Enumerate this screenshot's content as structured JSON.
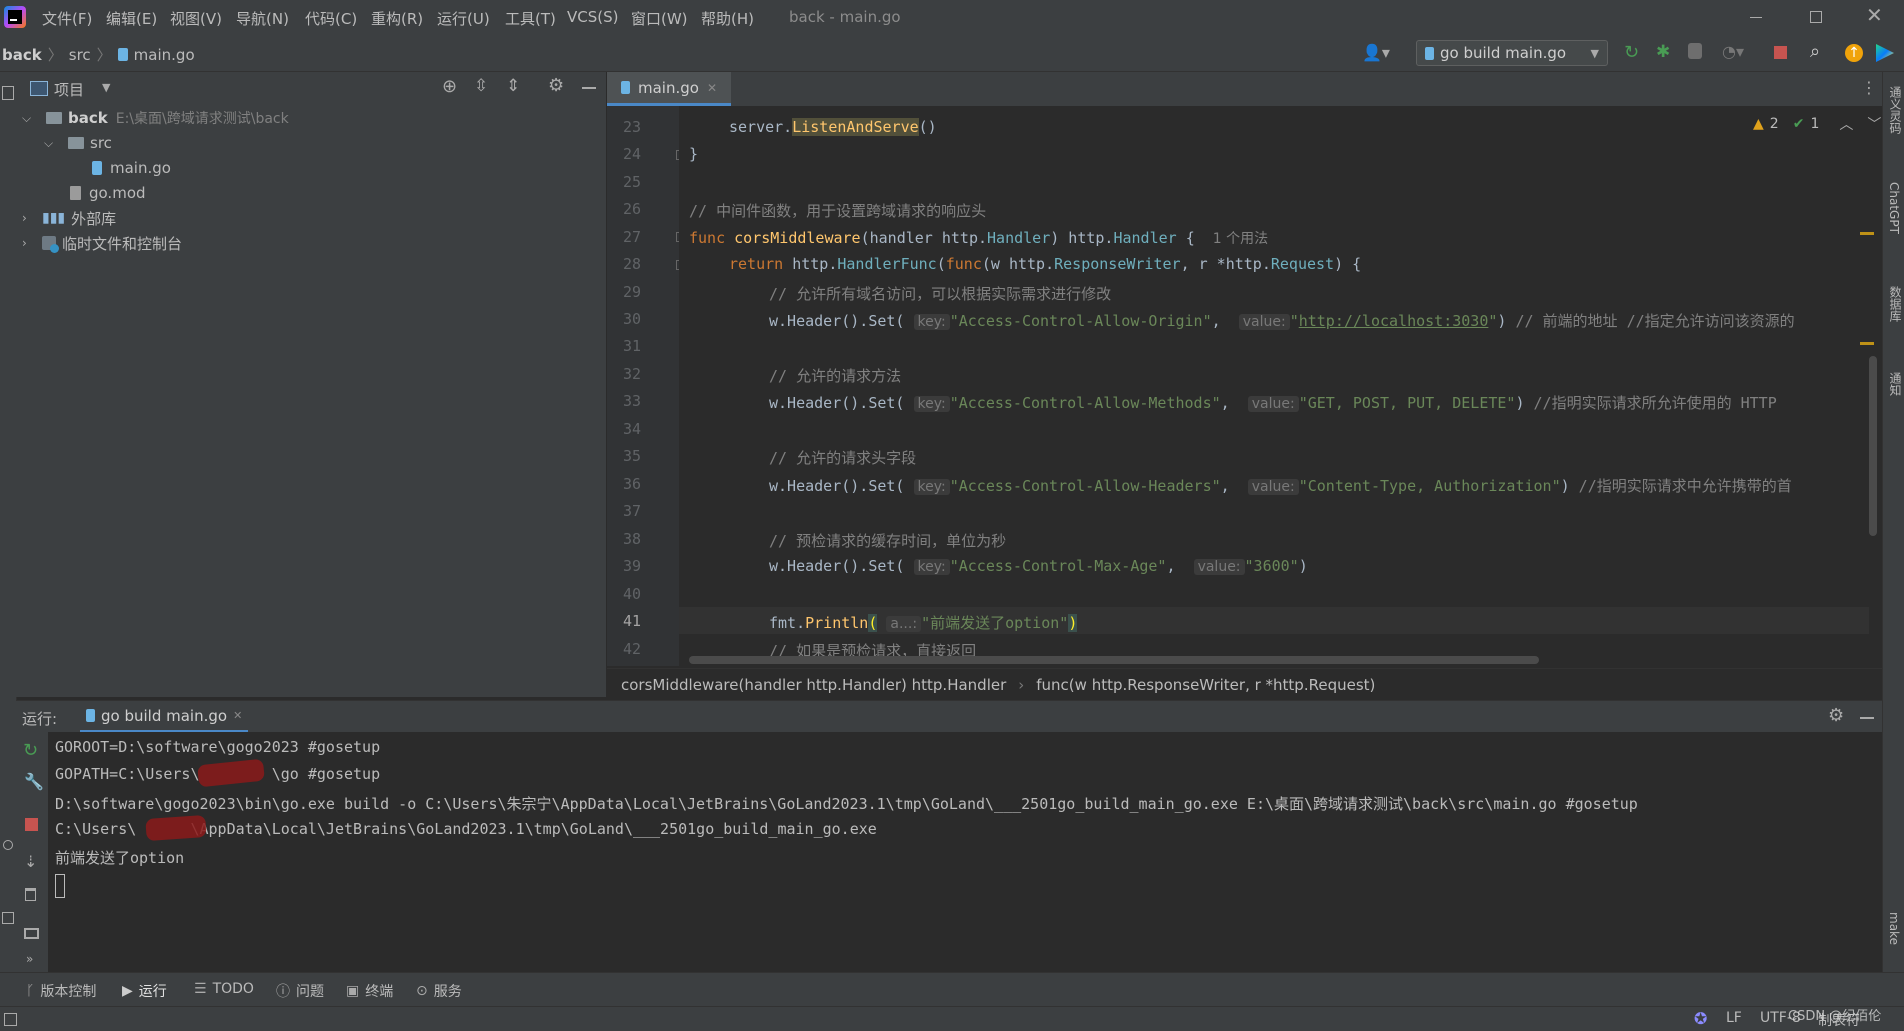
{
  "menu": {
    "items": [
      "文件(F)",
      "编辑(E)",
      "视图(V)",
      "导航(N)",
      "代码(C)",
      "重构(R)",
      "运行(U)",
      "工具(T)",
      "VCS(S)",
      "窗口(W)",
      "帮助(H)"
    ],
    "window_title": "back - main.go"
  },
  "nav": {
    "crumbs": [
      "back",
      "src",
      "main.go"
    ],
    "run_config": "go build main.go"
  },
  "project": {
    "header_label": "项目",
    "root_name": "back",
    "root_path": "E:\\桌面\\跨域请求测试\\back",
    "src": "src",
    "main_file": "main.go",
    "mod_file": "go.mod",
    "ext_libs": "外部库",
    "scratches": "临时文件和控制台"
  },
  "editor": {
    "tab_label": "main.go",
    "warnings": "2",
    "checks": "1",
    "usage_hint": "1 个用法",
    "line_numbers": [
      "23",
      "24",
      "25",
      "26",
      "27",
      "28",
      "29",
      "30",
      "31",
      "32",
      "33",
      "34",
      "35",
      "36",
      "37",
      "38",
      "39",
      "40",
      "41",
      "42"
    ],
    "code": {
      "l23_a": "server.",
      "l23_b": "ListenAndServe",
      "l23_c": "()",
      "l24": "}",
      "l26": "// 中间件函数，用于设置跨域请求的响应头",
      "l27_func": "func ",
      "l27_name": "corsMiddleware",
      "l27_params": "(handler http.",
      "l27_t1": "Handler",
      "l27_ret": ") http.",
      "l27_t2": "Handler",
      "l27_end": " {",
      "l28_return": "return ",
      "l28_pkg": "http.",
      "l28_fn": "HandlerFunc",
      "l28_open": "(",
      "l28_func": "func",
      "l28_params_a": "(w http.",
      "l28_t1": "ResponseWriter",
      "l28_params_b": ", r *http.",
      "l28_t2": "Request",
      "l28_end": ") {",
      "l29": "// 允许所有域名访问，可以根据实际需求进行修改",
      "l30_a": "w.Header().Set(",
      "l30_key_hint": "key:",
      "l30_key": "\"Access-Control-Allow-Origin\"",
      "l30_comma": ",",
      "l30_val_hint": "value:",
      "l30_q1": "\"",
      "l30_url": "http://localhost:3030",
      "l30_q2": "\"",
      "l30_close": ")",
      "l30_cm": " // 前端的地址 //指定允许访问该资源的",
      "l32": "// 允许的请求方法",
      "l33_a": "w.Header().Set(",
      "l33_key_hint": "key:",
      "l33_key": "\"Access-Control-Allow-Methods\"",
      "l33_comma": ",",
      "l33_val_hint": "value:",
      "l33_val": "\"GET, POST, PUT, DELETE\"",
      "l33_close": ")",
      "l33_cm": " //指明实际请求所允许使用的 HTTP",
      "l35": "// 允许的请求头字段",
      "l36_a": "w.Header().Set(",
      "l36_key_hint": "key:",
      "l36_key": "\"Access-Control-Allow-Headers\"",
      "l36_comma": ",",
      "l36_val_hint": "value:",
      "l36_val": "\"Content-Type, Authorization\"",
      "l36_close": ")",
      "l36_cm": " //指明实际请求中允许携带的首",
      "l38": "// 预检请求的缓存时间，单位为秒",
      "l39_a": "w.Header().Set(",
      "l39_key_hint": "key:",
      "l39_key": "\"Access-Control-Max-Age\"",
      "l39_comma": ",",
      "l39_val_hint": "value:",
      "l39_val": "\"3600\"",
      "l39_close": ")",
      "l41_a": "fmt.",
      "l41_fn": "Println",
      "l41_open": "(",
      "l41_hint": "a...:",
      "l41_str": "\"前端发送了option\"",
      "l41_close": ")",
      "l42": "// 如果是预检请求，直接返回"
    },
    "breadcrumb": [
      "corsMiddleware(handler http.Handler) http.Handler",
      "func(w http.ResponseWriter, r *http.Request)"
    ]
  },
  "run": {
    "label": "运行:",
    "tab": "go build main.go",
    "console": [
      "GOROOT=D:\\software\\gogo2023 #gosetup",
      "GOPATH=C:\\Users\\        \\go #gosetup",
      "D:\\software\\gogo2023\\bin\\go.exe build -o C:\\Users\\朱宗宁\\AppData\\Local\\JetBrains\\GoLand2023.1\\tmp\\GoLand\\___2501go_build_main_go.exe E:\\桌面\\跨域请求测试\\back\\src\\main.go #gosetup",
      "C:\\Users\\      \\AppData\\Local\\JetBrains\\GoLand2023.1\\tmp\\GoLand\\___2501go_build_main_go.exe",
      "前端发送了option"
    ]
  },
  "bottom_tabs": [
    "版本控制",
    "运行",
    "TODO",
    "问题",
    "终端",
    "服务"
  ],
  "status": {
    "line_sep": "LF",
    "encoding": "UTF-8",
    "indent": "制表符",
    "watermark": "CSDN @纪佰伦"
  },
  "right_strip": [
    "通义灵码",
    "ChatGPT",
    "数据库",
    "通知",
    "make"
  ],
  "colors": {
    "bg": "#2b2b2b",
    "panel": "#3c3f41",
    "keyword": "#cc7832",
    "function": "#ffc66d",
    "string": "#6a8759",
    "comment": "#808080",
    "run_green": "#499c54",
    "stop_red": "#c75450"
  }
}
